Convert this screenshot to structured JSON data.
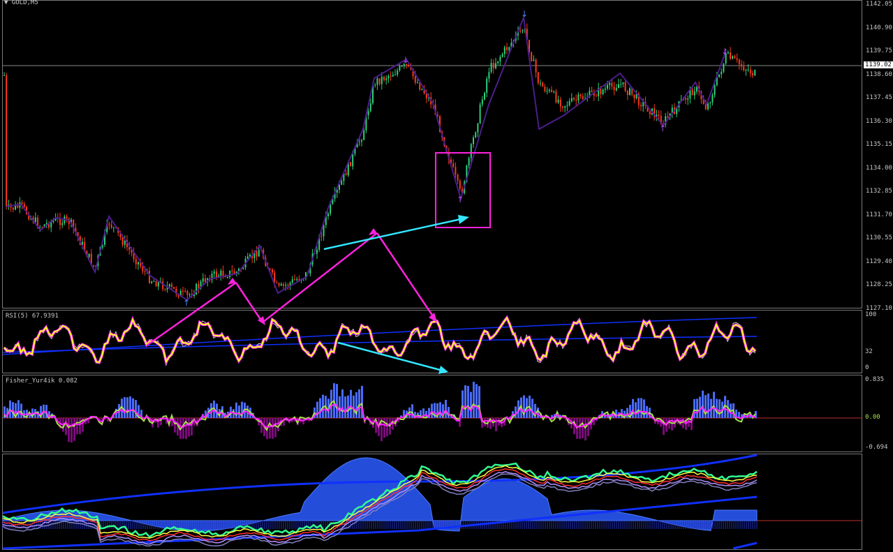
{
  "header": {
    "symbol_label": "GOLD,M5"
  },
  "colors": {
    "background": "#000000",
    "bull_candle": "#2fd07a",
    "bear_candle": "#ff3a1a",
    "zigzag": "#4b1e8a",
    "annotation_magenta": "#ff22dd",
    "annotation_cyan": "#33e6ff",
    "rsi_main": "#ffff22",
    "rsi_glow": "#ff22ff",
    "fisher_line": "#ff22ff",
    "fisher_signal": "#a8e04a",
    "hist_pos": "#4a6bff",
    "hist_neg": "#7a0a7a",
    "blue_band": "#1030ff"
  },
  "price_axis": {
    "ticks": [
      "1142.05",
      "1140.90",
      "1139.75",
      "1138.60",
      "1137.45",
      "1136.30",
      "1135.15",
      "1134.00",
      "1132.85",
      "1131.70",
      "1130.55",
      "1129.40",
      "1128.25",
      "1127.10"
    ],
    "current_price": "1139.02"
  },
  "rsi_panel": {
    "label": "RSI(5) 67.9391",
    "scale": [
      "100",
      "32",
      "0"
    ]
  },
  "fisher_panel": {
    "label": "Fisher_Yur4ik 0.082",
    "scale": [
      "0.835",
      "0.00",
      "-0.694"
    ]
  },
  "bands_panel": {
    "label": ""
  }
}
